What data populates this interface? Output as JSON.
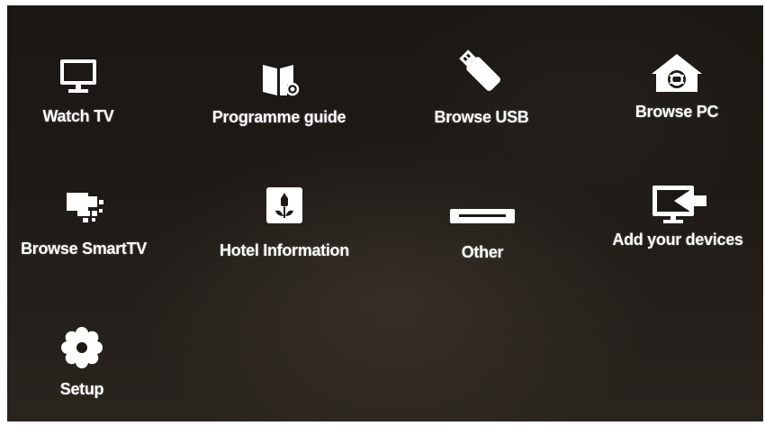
{
  "menu": {
    "items": [
      {
        "label": "Watch TV",
        "icon": "tv-icon"
      },
      {
        "label": "Programme guide",
        "icon": "book-guide-icon"
      },
      {
        "label": "Browse USB",
        "icon": "usb-stick-icon"
      },
      {
        "label": "Browse PC",
        "icon": "home-network-icon"
      },
      {
        "label": "Browse SmartTV",
        "icon": "smarttv-apps-icon"
      },
      {
        "label": "Hotel Information",
        "icon": "tulip-info-icon"
      },
      {
        "label": "Other",
        "icon": "disc-player-icon"
      },
      {
        "label": "Add your devices",
        "icon": "add-device-icon"
      },
      {
        "label": "Setup",
        "icon": "gear-icon"
      }
    ]
  },
  "colors": {
    "background": "#1c1915",
    "foreground": "#ffffff"
  }
}
